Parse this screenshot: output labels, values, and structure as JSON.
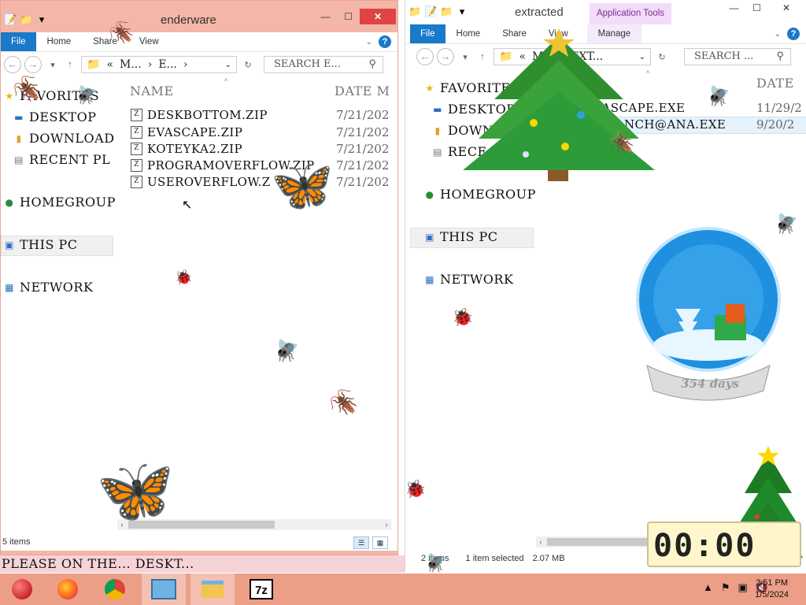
{
  "left_window": {
    "title": "enderware",
    "ribbon_tabs": [
      "File",
      "Home",
      "Share",
      "View"
    ],
    "address": [
      "«",
      "M...",
      "›",
      "E...",
      "›"
    ],
    "search_placeholder": "SEARCH E...",
    "nav": {
      "favorites": "FAVORITES",
      "desktop": "DESKTOP",
      "downloads": "DOWNLOAD",
      "recent": "RECENT PL",
      "homegroup": "HOMEGROUP",
      "thispc": "THIS PC",
      "network": "NETWORK"
    },
    "columns": {
      "name": "NAME",
      "date": "DATE M"
    },
    "files": [
      {
        "name": "DESKBOTTOM.ZIP",
        "date": "7/21/202"
      },
      {
        "name": "EVASCAPE.ZIP",
        "date": "7/21/202"
      },
      {
        "name": "KOTEYKA2.ZIP",
        "date": "7/21/202"
      },
      {
        "name": "PROGRAMOVERFLOW.ZIP",
        "date": "7/21/202"
      },
      {
        "name": "USEROVERFLOW.Z",
        "date": "7/21/202"
      }
    ],
    "status": "5 items"
  },
  "right_window": {
    "title": "extracted",
    "context_tab_group": "Application Tools",
    "ribbon_tabs": [
      "File",
      "Home",
      "Share",
      "View",
      "Manage"
    ],
    "address": [
      "«",
      "M...",
      "›",
      "EXT..."
    ],
    "search_placeholder": "SEARCH ...",
    "nav": {
      "favorites": "FAVORITES",
      "desktop": "DESKTOP",
      "downloads": "DOWNL",
      "recent": "RECE",
      "homegroup": "HOMEGROUP",
      "thispc": "THIS PC",
      "network": "NETWORK"
    },
    "columns": {
      "name": "ME",
      "date": "DATE"
    },
    "files": [
      {
        "name": "EVASCAPE.EXE",
        "date": "11/29/2"
      },
      {
        "name": "ERMANCH@ANA.EXE",
        "date": "9/20/2"
      }
    ],
    "status": {
      "items": "2 items",
      "selected": "1 item selected",
      "size": "2.07 MB"
    }
  },
  "banner_text": "PLEASE ON THE... DESKT...",
  "snowglobe_label": "354 days",
  "timer": "00:00",
  "taskbar": {
    "apps": [
      "ornament",
      "Firefox",
      "Chrome",
      "Remote Desktop",
      "File Explorer",
      "7z"
    ],
    "seven_zip_label": "7z",
    "time": "2:51 PM",
    "date": "1/5/2024"
  }
}
